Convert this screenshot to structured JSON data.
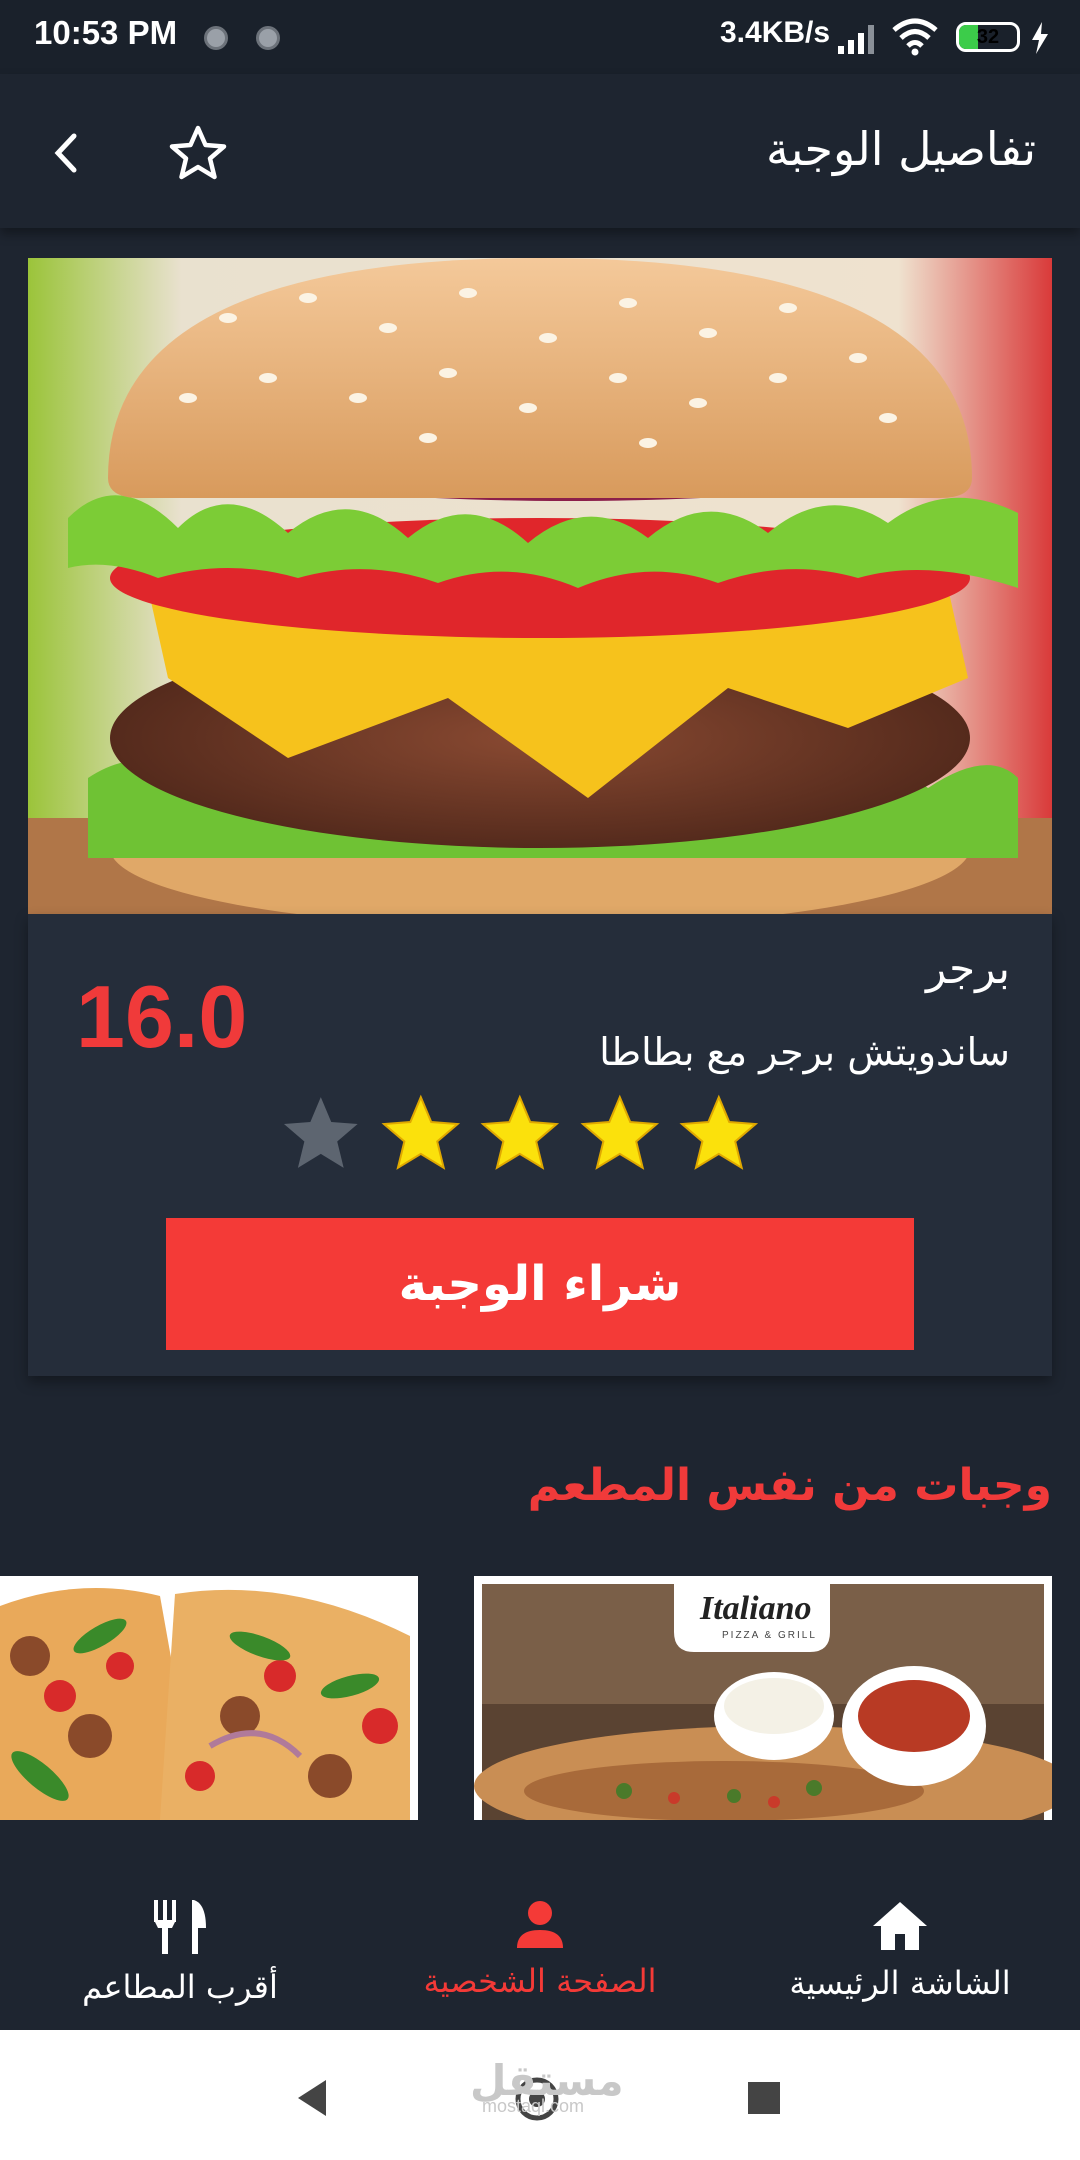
{
  "status_bar": {
    "time": "10:53 PM",
    "network_speed": "3.4KB/s",
    "battery_level": "32",
    "battery_fraction": 0.32,
    "icons": [
      "notification-dot-icon",
      "notification-dot-icon",
      "signal-icon",
      "wifi-icon",
      "battery-icon",
      "charging-icon"
    ]
  },
  "app_bar": {
    "title": "تفاصيل الوجبة",
    "back_icon": "chevron-left-icon",
    "favorite_icon": "star-outline-icon"
  },
  "meal": {
    "name": "برجر",
    "description": "ساندويتش برجر مع بطاطا",
    "price": "16.0",
    "rating": 4,
    "rating_max": 5,
    "buy_label": "شراء الوجبة"
  },
  "related": {
    "title": "وجبات من نفس المطعم",
    "items": [
      {
        "logo_text": "Italiano",
        "logo_sub": "PIZZA & GRILL"
      },
      {
        "logo_text": ""
      }
    ]
  },
  "bottom_nav": {
    "items": [
      {
        "label": "الشاشة الرئيسية",
        "icon": "home-icon",
        "active": false
      },
      {
        "label": "الصفحة الشخصية",
        "icon": "person-icon",
        "active": true
      },
      {
        "label": "أقرب المطاعم",
        "icon": "restaurant-icon",
        "active": false
      }
    ]
  },
  "system_nav": {
    "watermark": "مستقل",
    "watermark_sub": "mostaql.com"
  },
  "colors": {
    "background": "#1e2530",
    "card": "#252d3a",
    "accent": "#f43a37",
    "star_filled": "#fbe10c",
    "star_empty": "#5d6570"
  }
}
